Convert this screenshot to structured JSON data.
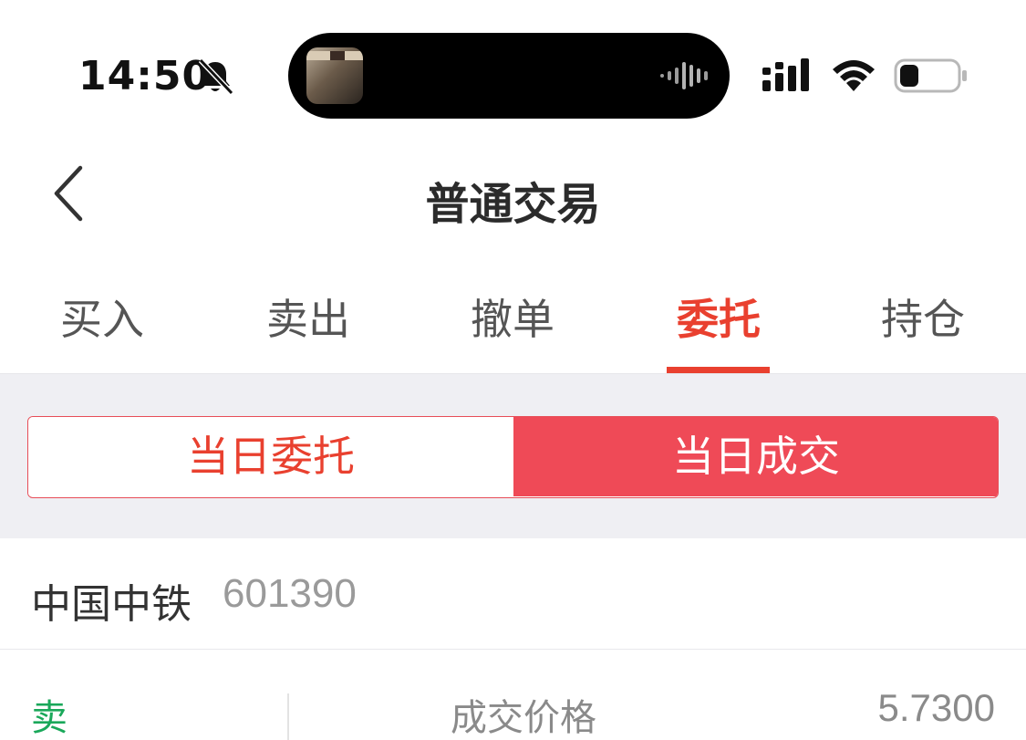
{
  "status_bar": {
    "time": "14:50",
    "icons": [
      "bell-slash-icon",
      "audio-wave-icon",
      "cellular-signal-icon",
      "wifi-icon",
      "battery-icon"
    ]
  },
  "nav": {
    "title": "普通交易",
    "back_icon": "chevron-left-icon"
  },
  "tabs": [
    {
      "label": "买入",
      "active": false
    },
    {
      "label": "卖出",
      "active": false
    },
    {
      "label": "撤单",
      "active": false
    },
    {
      "label": "委托",
      "active": true
    },
    {
      "label": "持仓",
      "active": false
    }
  ],
  "segment": {
    "left_label": "当日委托",
    "right_label": "当日成交",
    "selected": "当日成交"
  },
  "stock": {
    "name": "中国中铁",
    "code": "601390"
  },
  "detail": {
    "side": "卖",
    "price_label": "成交价格",
    "price_value": "5.7300"
  },
  "colors": {
    "accent": "#e9402f",
    "segment_active_bg": "#ef4a57",
    "sell_green": "#1aa85a",
    "band_bg": "#efeff3"
  }
}
